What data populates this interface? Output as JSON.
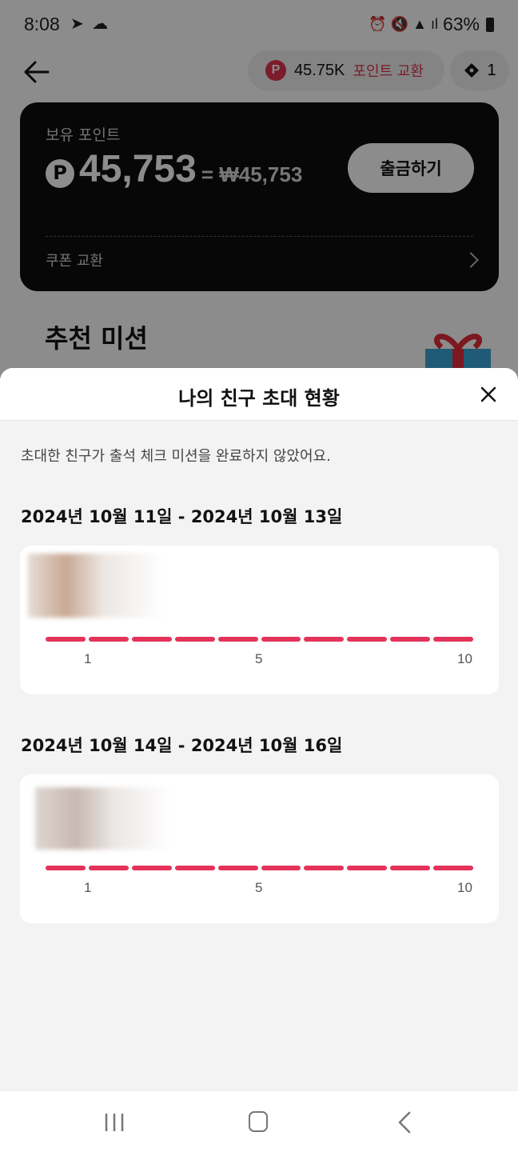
{
  "status_bar": {
    "time": "8:08",
    "battery": "63%"
  },
  "header": {
    "points_value": "45.75K",
    "points_exchange_label": "포인트 교환",
    "ticket_count": "1"
  },
  "balance_card": {
    "label": "보유 포인트",
    "amount": "45,753",
    "won_equivalent": "= ₩45,753",
    "withdraw_label": "출금하기",
    "coupon_label": "쿠폰 교환"
  },
  "recommend": {
    "title": "추천 미션"
  },
  "sheet": {
    "title": "나의 친구 초대 현황",
    "description": "초대한 친구가 출석 체크 미션을 완료하지 않았어요.",
    "groups": [
      {
        "period": "2024년 10월 11일 - 2024년 10월 13일",
        "progress": {
          "segments": 10,
          "filled": 10
        },
        "ticks": [
          "1",
          "5",
          "10"
        ]
      },
      {
        "period": "2024년 10월 14일 - 2024년 10월 16일",
        "progress": {
          "segments": 10,
          "filled": 10
        },
        "ticks": [
          "1",
          "5",
          "10"
        ]
      }
    ]
  },
  "colors": {
    "accent": "#e4335a",
    "card_dark": "#0d0d0d",
    "sheet_bg": "#f3f3f3"
  },
  "icons": [
    "back-arrow-icon",
    "p-point-icon",
    "ticket-icon",
    "chevron-right-icon",
    "gift-icon",
    "close-icon",
    "nav-recent-icon",
    "nav-home-icon",
    "nav-back-icon"
  ]
}
